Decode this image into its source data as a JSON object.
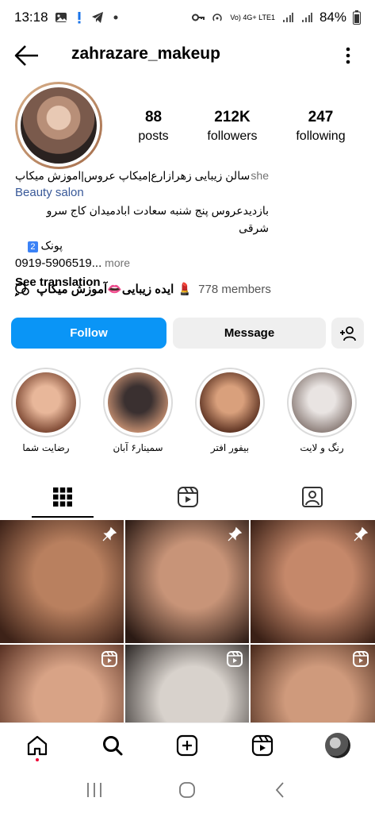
{
  "status_bar": {
    "time": "13:18",
    "battery": "84%",
    "network": "Vo) 4G+ LTE1"
  },
  "header": {
    "username": "zahrazare_makeup"
  },
  "stats": [
    {
      "number": "88",
      "label": "posts"
    },
    {
      "number": "212K",
      "label": "followers"
    },
    {
      "number": "247",
      "label": "following"
    }
  ],
  "bio": {
    "pronoun": "she",
    "line1": "سالن زیبایی زهرازارع|میکاپ عروس|اموزش میکاپ",
    "category": "Beauty salon",
    "line2": "بازدیدعروس پنج شنبه سعادت ابادمیدان کاج سرو شرقی",
    "line3": "پونک",
    "badge": "2",
    "phone": "0919-5906519...",
    "more": " more",
    "see_translation": "See translation"
  },
  "channel": {
    "name": "💄 ایده زیبایی👄آموزش میکاپ",
    "members": "778 members"
  },
  "buttons": {
    "follow": "Follow",
    "message": "Message"
  },
  "highlights": [
    {
      "label": "رضایت شما",
      "color_a": "#e8b79a",
      "color_b": "#7a4530"
    },
    {
      "label": "سمینار۶ آبان",
      "color_a": "#3a3030",
      "color_b": "#c48e70"
    },
    {
      "label": "بیفور افتر",
      "color_a": "#d9a07c",
      "color_b": "#5a3020"
    },
    {
      "label": "رنگ و لایت",
      "color_a": "#e9e4e2",
      "color_b": "#8b7d78"
    }
  ],
  "grid": [
    {
      "badge": "pin",
      "c1": "#b9805f",
      "c2": "#3d2218"
    },
    {
      "badge": "pin",
      "c1": "#c89478",
      "c2": "#2b1a14"
    },
    {
      "badge": "pin",
      "c1": "#c5886a",
      "c2": "#3a2016"
    },
    {
      "badge": "reel",
      "c1": "#d8a386",
      "c2": "#5a3224"
    },
    {
      "badge": "reel",
      "c1": "#d8d2cc",
      "c2": "#2f2a28"
    },
    {
      "badge": "reel",
      "c1": "#cf9a7c",
      "c2": "#4a2a1c"
    }
  ],
  "colors": {
    "follow_blue": "#0a95f6",
    "link_blue": "#385898"
  }
}
